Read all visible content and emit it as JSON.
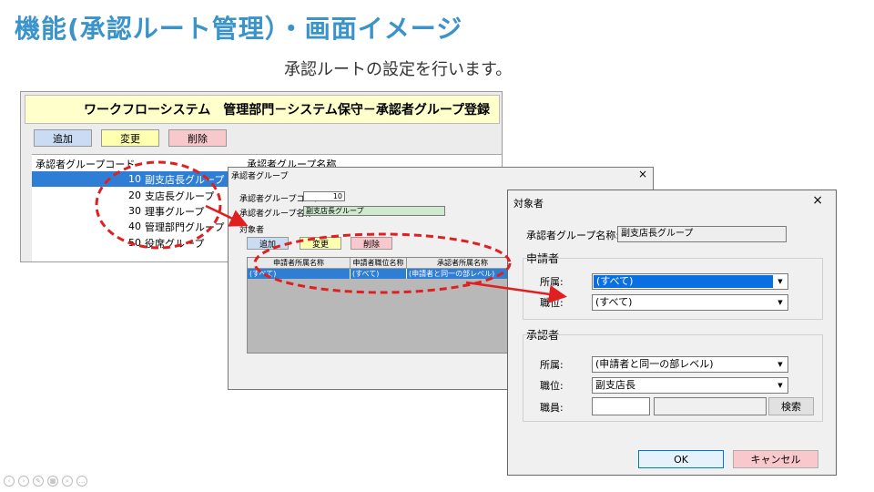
{
  "slide": {
    "title": "機能(承認ルート管理）・画面イメージ",
    "subtitle": "承認ルートの設定を行います。"
  },
  "win1": {
    "title": "ワークフローシステム　管理部門－システム保守－承認者グループ登録",
    "buttons": {
      "add": "追加",
      "edit": "変更",
      "delete": "削除"
    },
    "col_code": "承認者グループコード",
    "col_name": "承認者グループ名称",
    "rows": [
      {
        "code": "10",
        "name": "副支店長グループ"
      },
      {
        "code": "20",
        "name": "支店長グループ"
      },
      {
        "code": "30",
        "name": "理事グループ"
      },
      {
        "code": "40",
        "name": "管理部門グループ"
      },
      {
        "code": "50",
        "name": "役席グループ"
      }
    ]
  },
  "win2": {
    "title": "承認者グループ",
    "close": "×",
    "code_label": "承認者グループコード",
    "code_value": "10",
    "name_label": "承認者グループ名称",
    "name_value": "副支店長グループ",
    "section": "対象者",
    "buttons": {
      "add": "追加",
      "edit": "変更",
      "delete": "削除"
    },
    "columns": [
      "申請者所属名称",
      "申請者職位名称",
      "承認者所属名称"
    ],
    "row": [
      "(すべて)",
      "(すべて)",
      "(申請者と同一の部レベル)"
    ]
  },
  "win3": {
    "title": "対象者",
    "close": "×",
    "group_name_label": "承認者グループ名称:",
    "group_name_value": "副支店長グループ",
    "applicant": {
      "section": "申請者",
      "affiliation_label": "所属:",
      "affiliation_value": "(すべて)",
      "position_label": "職位:",
      "position_value": "(すべて)"
    },
    "approver": {
      "section": "承認者",
      "affiliation_label": "所属:",
      "affiliation_value": "(申請者と同一の部レベル)",
      "position_label": "職位:",
      "position_value": "副支店長",
      "staff_label": "職員:",
      "search_button": "検索"
    },
    "ok_button": "OK",
    "cancel_button": "キャンセル"
  },
  "colors": {
    "title": "#3a93c9",
    "selection": "#2e7ed6",
    "annotation": "#e02020"
  }
}
